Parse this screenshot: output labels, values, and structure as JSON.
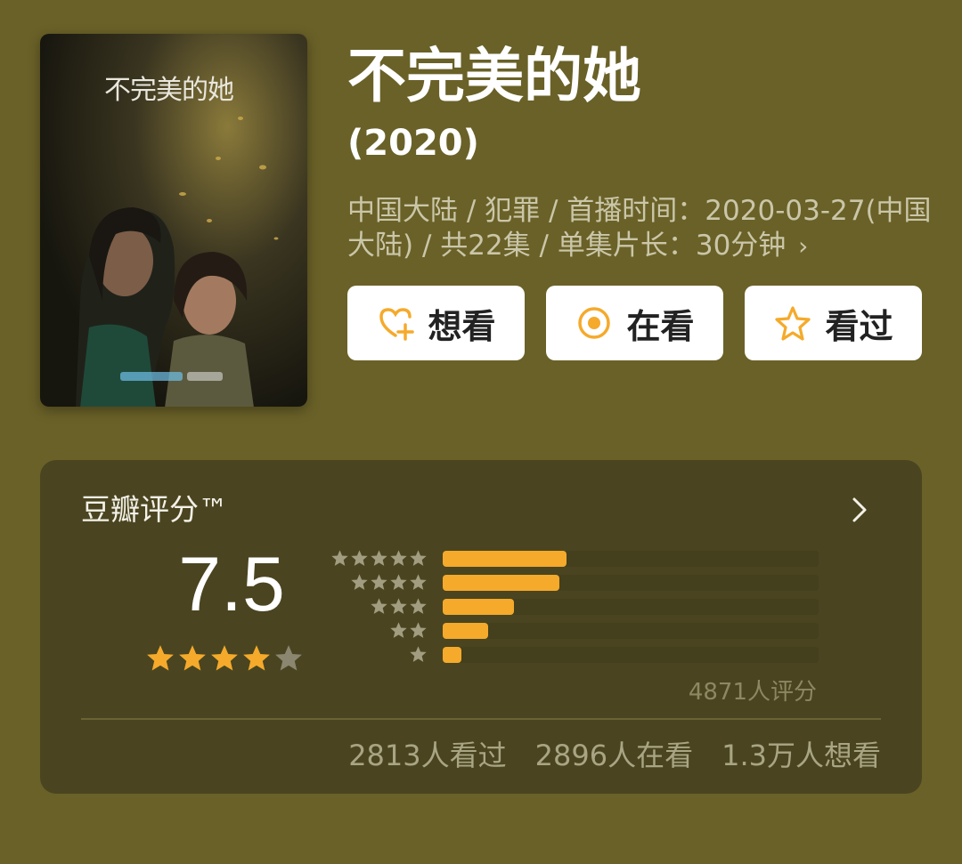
{
  "poster": {
    "title_art": "不完美的她"
  },
  "title": "不完美的她",
  "year": "(2020)",
  "meta": {
    "text": "中国大陆 / 犯罪 / 首播时间：2020-03-27(中国大陆) / 共22集 / 单集片长：30分钟",
    "chevron": "›"
  },
  "actions": {
    "want": {
      "label": "想看",
      "icon": "heart-plus-icon"
    },
    "watching": {
      "label": "在看",
      "icon": "target-icon"
    },
    "watched": {
      "label": "看过",
      "icon": "star-outline-icon"
    }
  },
  "rating": {
    "title": "豆瓣评分™",
    "score": "7.5",
    "stars_filled": 4,
    "stars_total": 5,
    "distribution_fraction": [
      0.33,
      0.31,
      0.19,
      0.12,
      0.05
    ],
    "count": "4871人评分",
    "stats": [
      "2813人看过",
      "2896人在看",
      "1.3万人想看"
    ]
  },
  "colors": {
    "background": "#6a6128",
    "card": "#4a4520",
    "accent": "#f5aa2b",
    "button_bg": "#ffffff"
  }
}
